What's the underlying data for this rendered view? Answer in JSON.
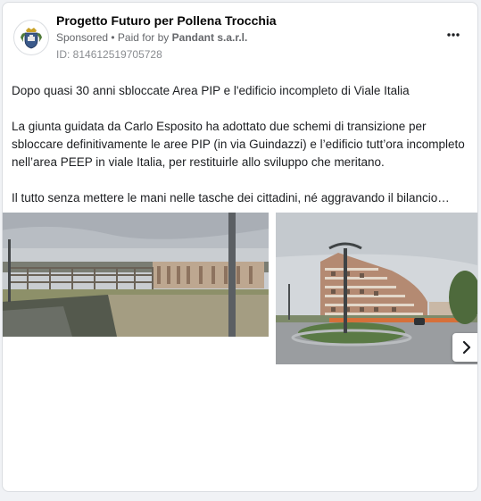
{
  "ad": {
    "page_name": "Progetto Futuro per Pollena Trocchia",
    "sponsored": "Sponsored",
    "separator": " • ",
    "paid_for_by": "Paid for by",
    "payer": "Pandant s.a.r.l.",
    "ad_id": "ID: 814612519705728",
    "more_icon": "more-horizontal-icon"
  },
  "post": {
    "headline": "Dopo quasi 30 anni sbloccate Area PIP e l'edificio incompleto di Viale Italia",
    "paragraph": "La giunta guidata da Carlo Esposito ha adottato due schemi di transizione per sbloccare definitivamente le aree PIP (in via Guindazzi) e l’edificio tutt’ora incompleto nell’area PEEP in viale Italia, per restituirle allo sviluppo che meritano.",
    "teaser": "Il tutto senza mettere le mani nelle tasche dei cittadini, né aggravando il bilancio…"
  },
  "carousel": {
    "next_icon": "chevron-right-icon"
  },
  "colors": {
    "sky": "#c8cdd2",
    "grass": "#6e7f52",
    "building": "#a8826a",
    "text": "#1c1e21",
    "muted": "#65676b"
  }
}
